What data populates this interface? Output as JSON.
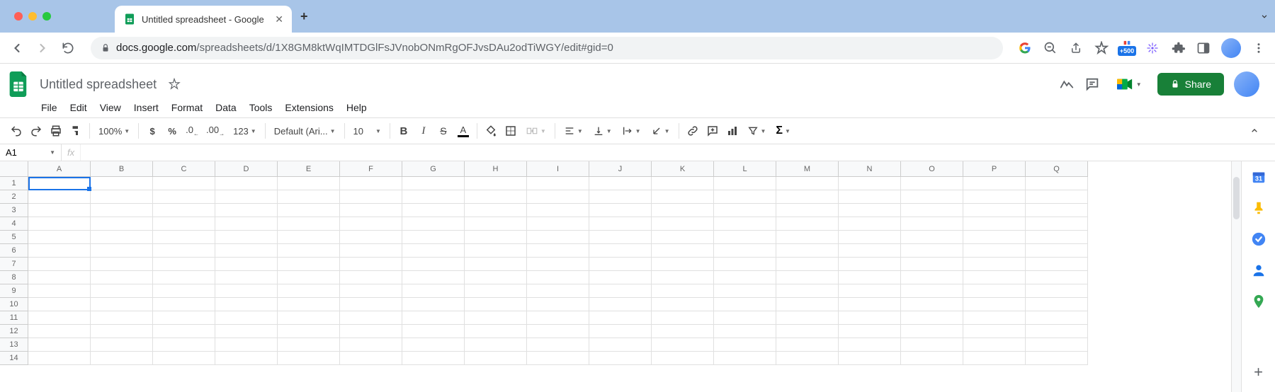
{
  "browser": {
    "tab_title": "Untitled spreadsheet - Google",
    "url_domain": "docs.google.com",
    "url_path": "/spreadsheets/d/1X8GM8ktWqIMTDGlFsJVnobONmRgOFJvsDAu2odTiWGY/edit#gid=0",
    "lens_badge": "+500"
  },
  "doc": {
    "title": "Untitled spreadsheet",
    "menus": [
      "File",
      "Edit",
      "View",
      "Insert",
      "Format",
      "Data",
      "Tools",
      "Extensions",
      "Help"
    ],
    "share_label": "Share"
  },
  "toolbar": {
    "zoom": "100%",
    "font": "Default (Ari...",
    "font_size": "10",
    "number_format": "123"
  },
  "namebox": {
    "value": "A1",
    "fx": "fx"
  },
  "grid": {
    "columns": [
      "A",
      "B",
      "C",
      "D",
      "E",
      "F",
      "G",
      "H",
      "I",
      "J",
      "K",
      "L",
      "M",
      "N",
      "O",
      "P",
      "Q"
    ],
    "rows": [
      1,
      2,
      3,
      4,
      5,
      6,
      7,
      8,
      9,
      10,
      11,
      12,
      13,
      14
    ],
    "selected": "A1"
  }
}
